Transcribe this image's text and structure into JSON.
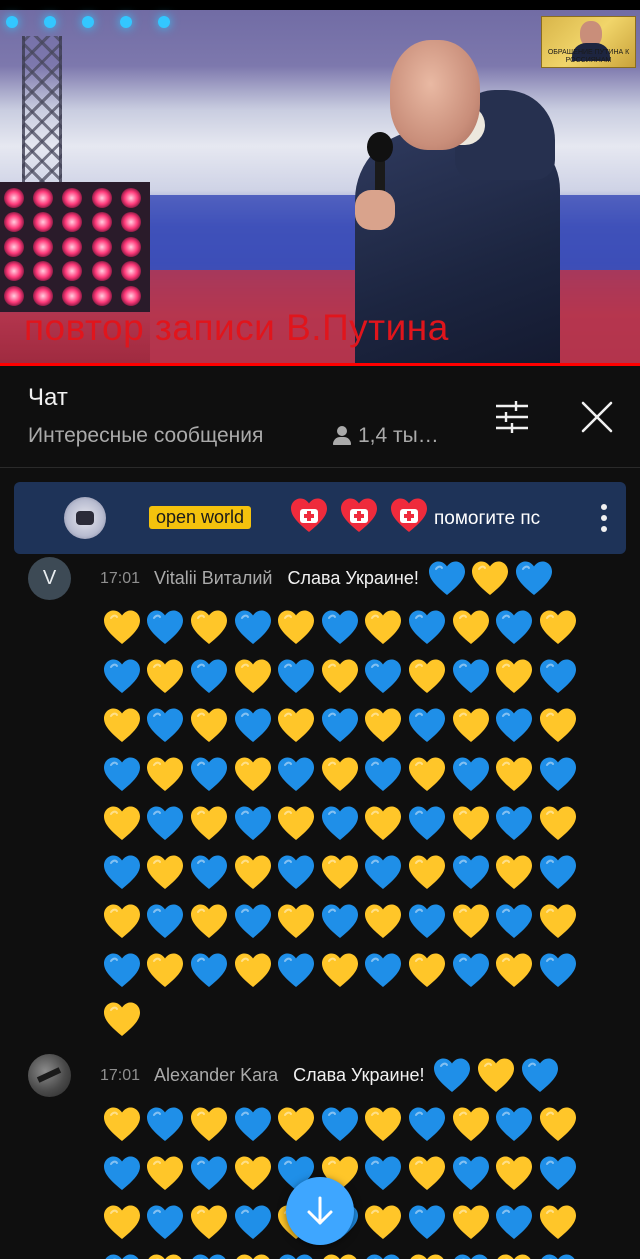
{
  "video": {
    "caption": "повтор записи В.Путина",
    "thumbnail_text": "ОБРАЩЕНИЕ ПУТИНА К РОССИЯНАМ"
  },
  "chat_header": {
    "title": "Чат",
    "subtitle": "Интересные сообщения",
    "viewers": "1,4 ты…",
    "icons": {
      "filter": "tune-icon",
      "close": "close-icon",
      "viewers": "person-icon"
    }
  },
  "pinned": {
    "badge": "open world",
    "text": "помогите пс",
    "heart_count": 3,
    "icons": {
      "avatar": "gamepad-avatar",
      "heart": "red-heart-cross-icon",
      "more": "more-vert-icon"
    }
  },
  "messages": [
    {
      "time": "17:01",
      "author": "Vitalii Виталий",
      "text": "Слава Украине!",
      "avatar_letter": "V",
      "avatar_color": "#3d4a55",
      "first_line_hearts": [
        "blue",
        "yellow",
        "blue"
      ],
      "heart_rows": [
        [
          "yellow",
          "blue",
          "yellow",
          "blue",
          "yellow",
          "blue",
          "yellow",
          "blue",
          "yellow",
          "blue",
          "yellow"
        ],
        [
          "blue",
          "yellow",
          "blue",
          "yellow",
          "blue",
          "yellow",
          "blue",
          "yellow",
          "blue",
          "yellow",
          "blue"
        ],
        [
          "yellow",
          "blue",
          "yellow",
          "blue",
          "yellow",
          "blue",
          "yellow",
          "blue",
          "yellow",
          "blue",
          "yellow"
        ],
        [
          "blue",
          "yellow",
          "blue",
          "yellow",
          "blue",
          "yellow",
          "blue",
          "yellow",
          "blue",
          "yellow",
          "blue"
        ],
        [
          "yellow",
          "blue",
          "yellow",
          "blue",
          "yellow",
          "blue",
          "yellow",
          "blue",
          "yellow",
          "blue",
          "yellow"
        ],
        [
          "blue",
          "yellow",
          "blue",
          "yellow",
          "blue",
          "yellow",
          "blue",
          "yellow",
          "blue",
          "yellow",
          "blue"
        ],
        [
          "yellow",
          "blue",
          "yellow",
          "blue",
          "yellow",
          "blue",
          "yellow",
          "blue",
          "yellow",
          "blue",
          "yellow"
        ],
        [
          "blue",
          "yellow",
          "blue",
          "yellow",
          "blue",
          "yellow",
          "blue",
          "yellow",
          "blue",
          "yellow",
          "blue"
        ],
        [
          "yellow"
        ]
      ]
    },
    {
      "time": "17:01",
      "author": "Alexander Kara",
      "text": "Слава Украине!",
      "avatar_letter": "",
      "avatar_color": "#4a4a4a",
      "first_line_hearts": [
        "blue",
        "yellow",
        "blue"
      ],
      "heart_rows": [
        [
          "yellow",
          "blue",
          "yellow",
          "blue",
          "yellow",
          "blue",
          "yellow",
          "blue",
          "yellow",
          "blue",
          "yellow"
        ],
        [
          "blue",
          "yellow",
          "blue",
          "yellow",
          "blue",
          "yellow",
          "blue",
          "yellow",
          "blue",
          "yellow",
          "blue"
        ],
        [
          "yellow",
          "blue",
          "yellow",
          "blue",
          "yellow",
          "blue",
          "yellow",
          "blue",
          "yellow",
          "blue",
          "yellow"
        ],
        [
          "blue",
          "yellow",
          "blue",
          "yellow",
          "blue",
          "yellow",
          "blue",
          "yellow",
          "blue",
          "yellow",
          "blue"
        ]
      ]
    }
  ],
  "colors": {
    "heart_blue": "#1f8fe8",
    "heart_yellow": "#ffc629",
    "heart_red": "#ef2b3c",
    "accent": "#3ea6ff",
    "ticker_bg": "#1e3358",
    "caption_red": "#e0151c"
  },
  "fab": {
    "icon": "arrow-down-icon"
  }
}
